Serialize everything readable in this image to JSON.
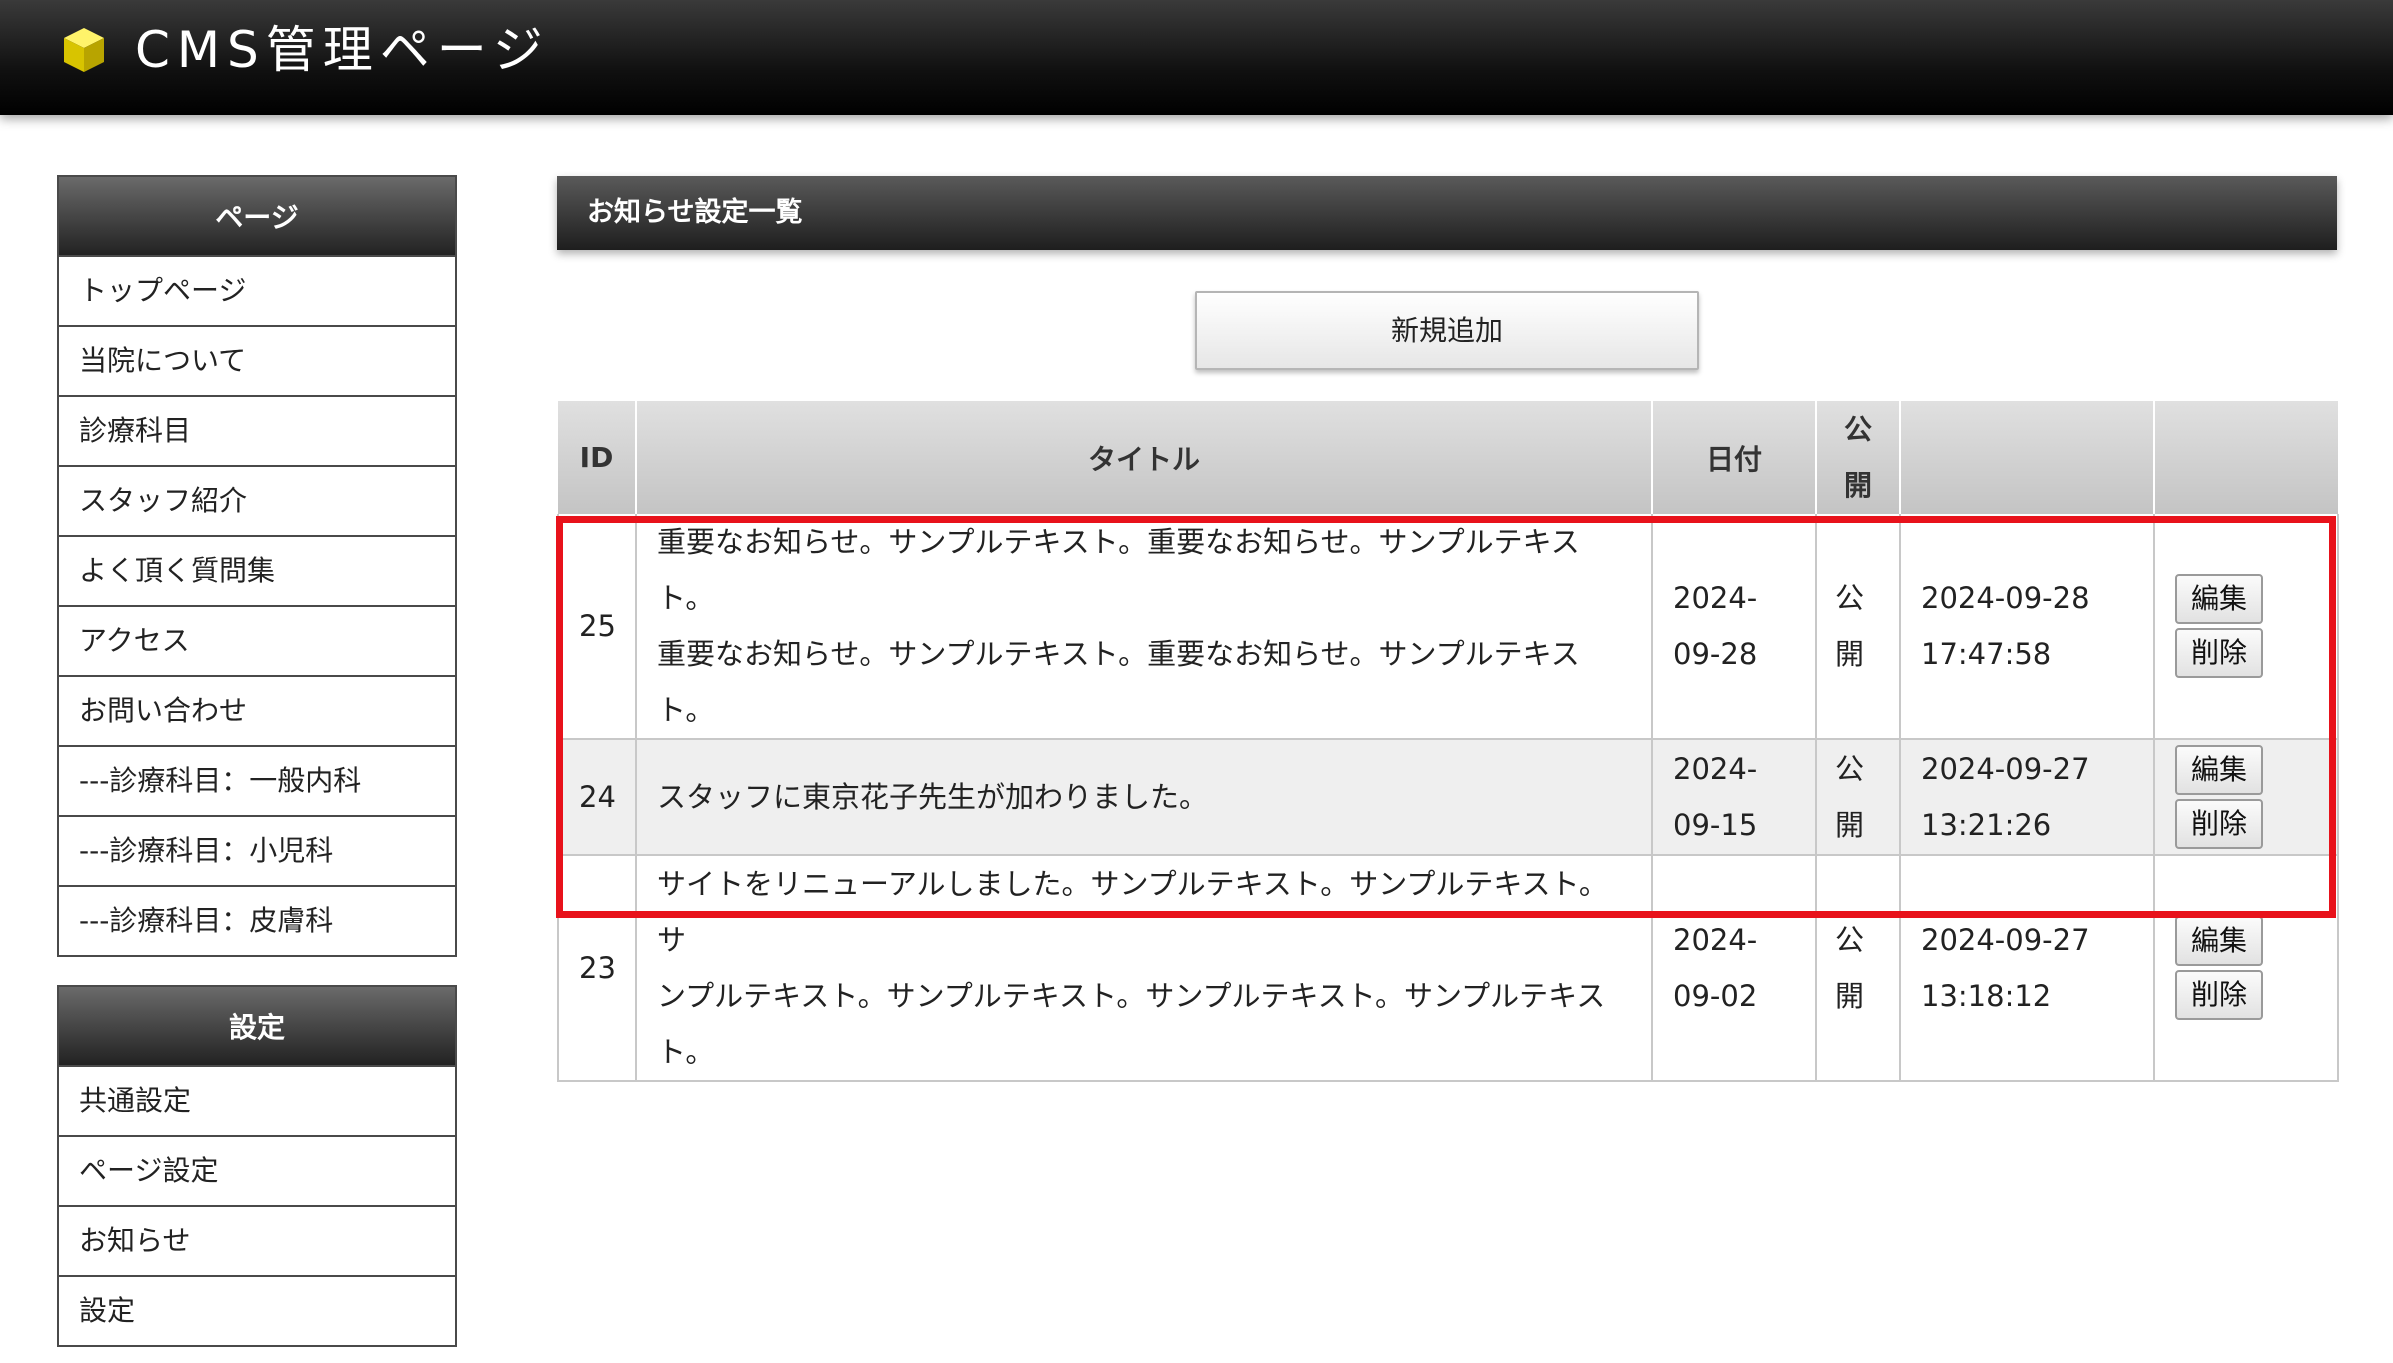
{
  "header": {
    "title": "CMS管理ページ",
    "logo_icon": "yellow-cube-icon"
  },
  "sidebar": {
    "pages": {
      "heading": "ページ",
      "items": [
        "トップページ",
        "当院について",
        "診療科目",
        "スタッフ紹介",
        "よく頂く質問集",
        "アクセス",
        "お問い合わせ",
        "---診療科目：一般内科",
        "---診療科目：小児科",
        "---診療科目：皮膚科"
      ]
    },
    "settings": {
      "heading": "設定",
      "items": [
        "共通設定",
        "ページ設定",
        "お知らせ",
        "設定"
      ]
    }
  },
  "main": {
    "panel_title": "お知らせ設定一覧",
    "add_button": "新規追加",
    "table": {
      "headers": {
        "id": "ID",
        "title": "タイトル",
        "date": "日付",
        "pub1": "公",
        "pub2": "開",
        "updated": "",
        "actions": ""
      },
      "rows": [
        {
          "id": "25",
          "title_lines": [
            "重要なお知らせ。サンプルテキスト。重要なお知らせ。サンプルテキスト。",
            "重要なお知らせ。サンプルテキスト。重要なお知らせ。サンプルテキスト。"
          ],
          "date_lines": [
            "2024-",
            "09-28"
          ],
          "pub_lines": [
            "公",
            "開"
          ],
          "updated_lines": [
            "2024-09-28",
            "17:47:58"
          ],
          "edit": "編集",
          "delete": "削除"
        },
        {
          "id": "24",
          "title_lines": [
            "スタッフに東京花子先生が加わりました。"
          ],
          "date_lines": [
            "2024-",
            "09-15"
          ],
          "pub_lines": [
            "公",
            "開"
          ],
          "updated_lines": [
            "2024-09-27",
            "13:21:26"
          ],
          "edit": "編集",
          "delete": "削除"
        },
        {
          "id": "23",
          "title_lines": [
            "サイトをリニューアルしました。サンプルテキスト。サンプルテキスト。サ",
            "ンプルテキスト。サンプルテキスト。サンプルテキスト。サンプルテキス",
            "ト。"
          ],
          "date_lines": [
            "2024-",
            "09-02"
          ],
          "pub_lines": [
            "公",
            "開"
          ],
          "updated_lines": [
            "2024-09-27",
            "13:18:12"
          ],
          "edit": "編集",
          "delete": "削除"
        }
      ]
    }
  },
  "colors": {
    "highlight": "#e8121b",
    "header_bg": "#111111"
  }
}
